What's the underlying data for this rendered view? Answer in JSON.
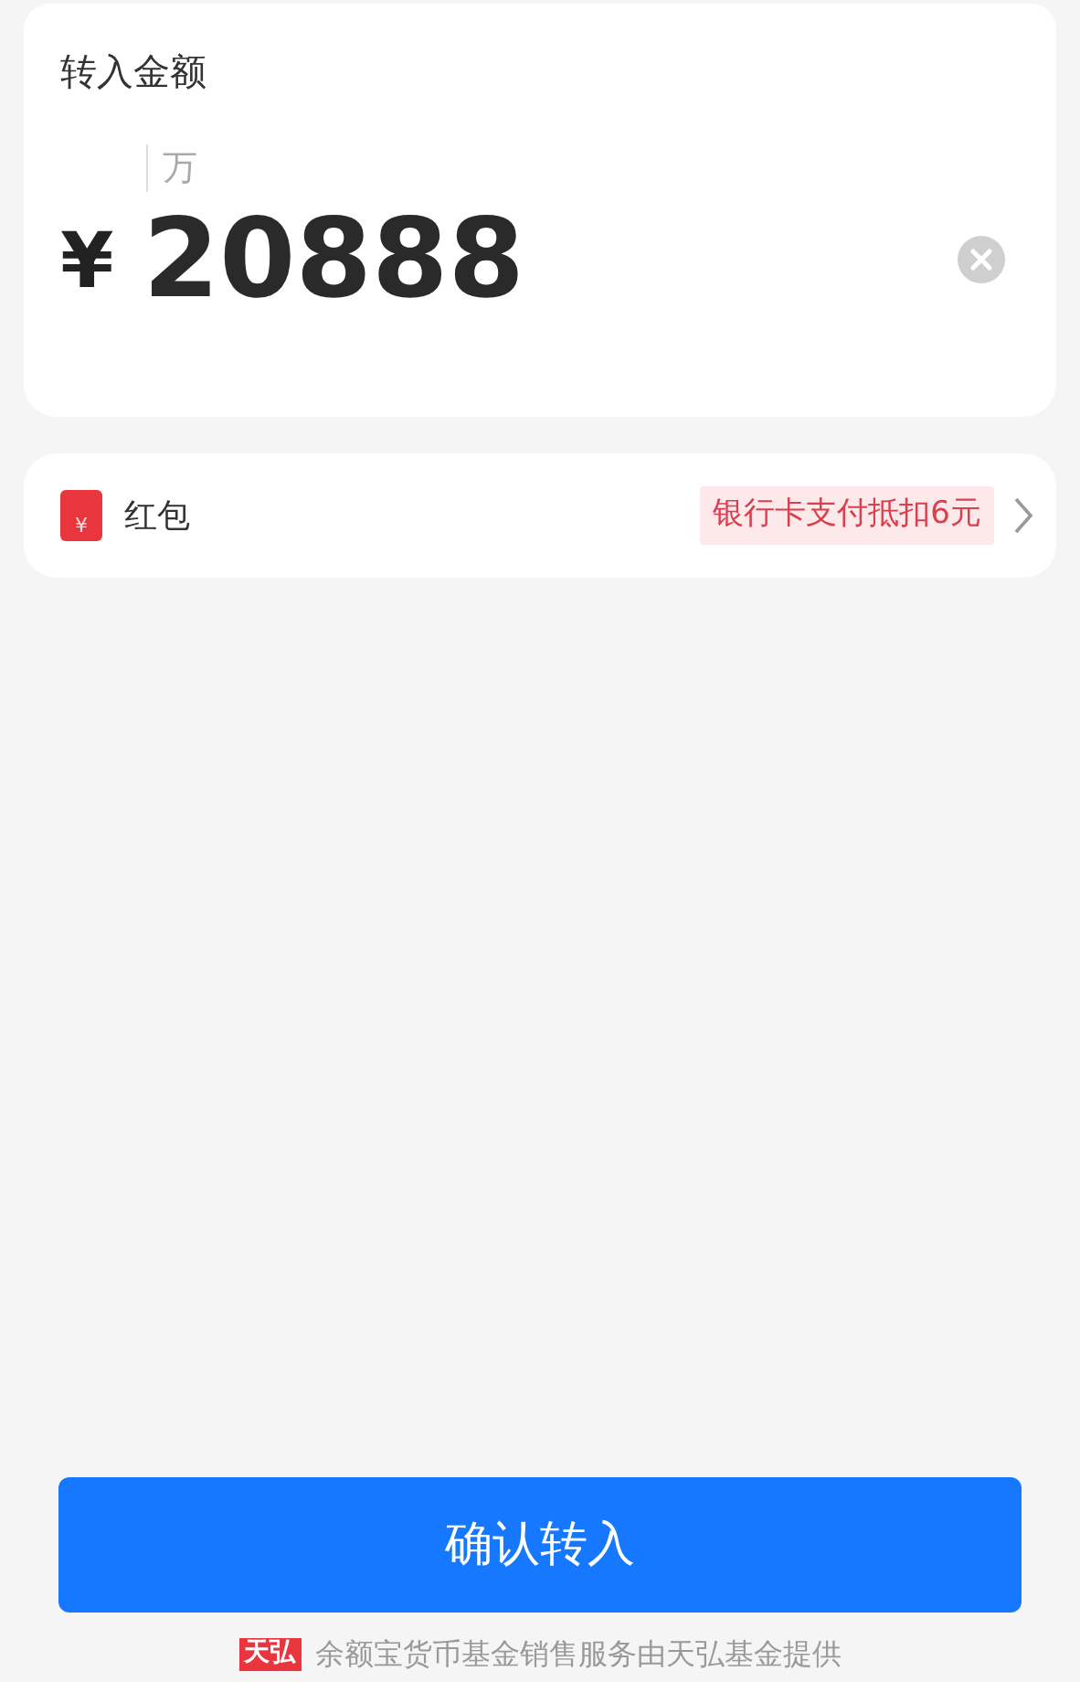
{
  "amount_card": {
    "title": "转入金额",
    "unit_hint": "万",
    "currency": "¥",
    "value": "20888"
  },
  "red_packet": {
    "icon_glyph": "¥",
    "label": "红包",
    "offer": "银行卡支付抵扣6元"
  },
  "confirm_button": {
    "label": "确认转入"
  },
  "footer": {
    "logo": "天弘",
    "text": "余额宝货币基金销售服务由天弘基金提供"
  }
}
